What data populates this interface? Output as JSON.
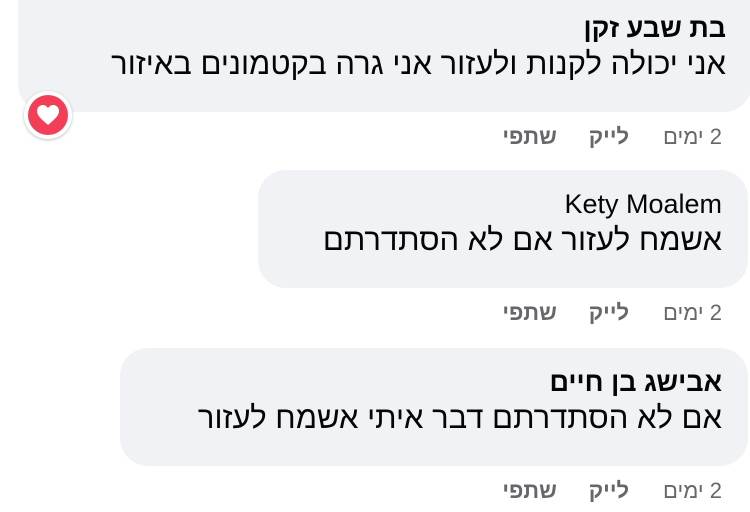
{
  "comments": [
    {
      "author": "בת שבע זקן",
      "text": "אני יכולה לקנות ולעזור אני גרה בקטמונים באיזור",
      "time": "2 ימים",
      "like_label": "לייק",
      "reply_label": "שתפי",
      "reaction_icon": "heart-icon",
      "reaction_color": "#f33e58"
    },
    {
      "author": "Kety Moalem",
      "text": "אשמח לעזור אם לא הסתדרתם",
      "time": "2 ימים",
      "like_label": "לייק",
      "reply_label": "שתפי"
    },
    {
      "author": "אבישג בן חיים",
      "text": "אם לא הסתדרתם דבר איתי אשמח לעזור",
      "time": "2 ימים",
      "like_label": "לייק",
      "reply_label": "שתפי"
    }
  ]
}
